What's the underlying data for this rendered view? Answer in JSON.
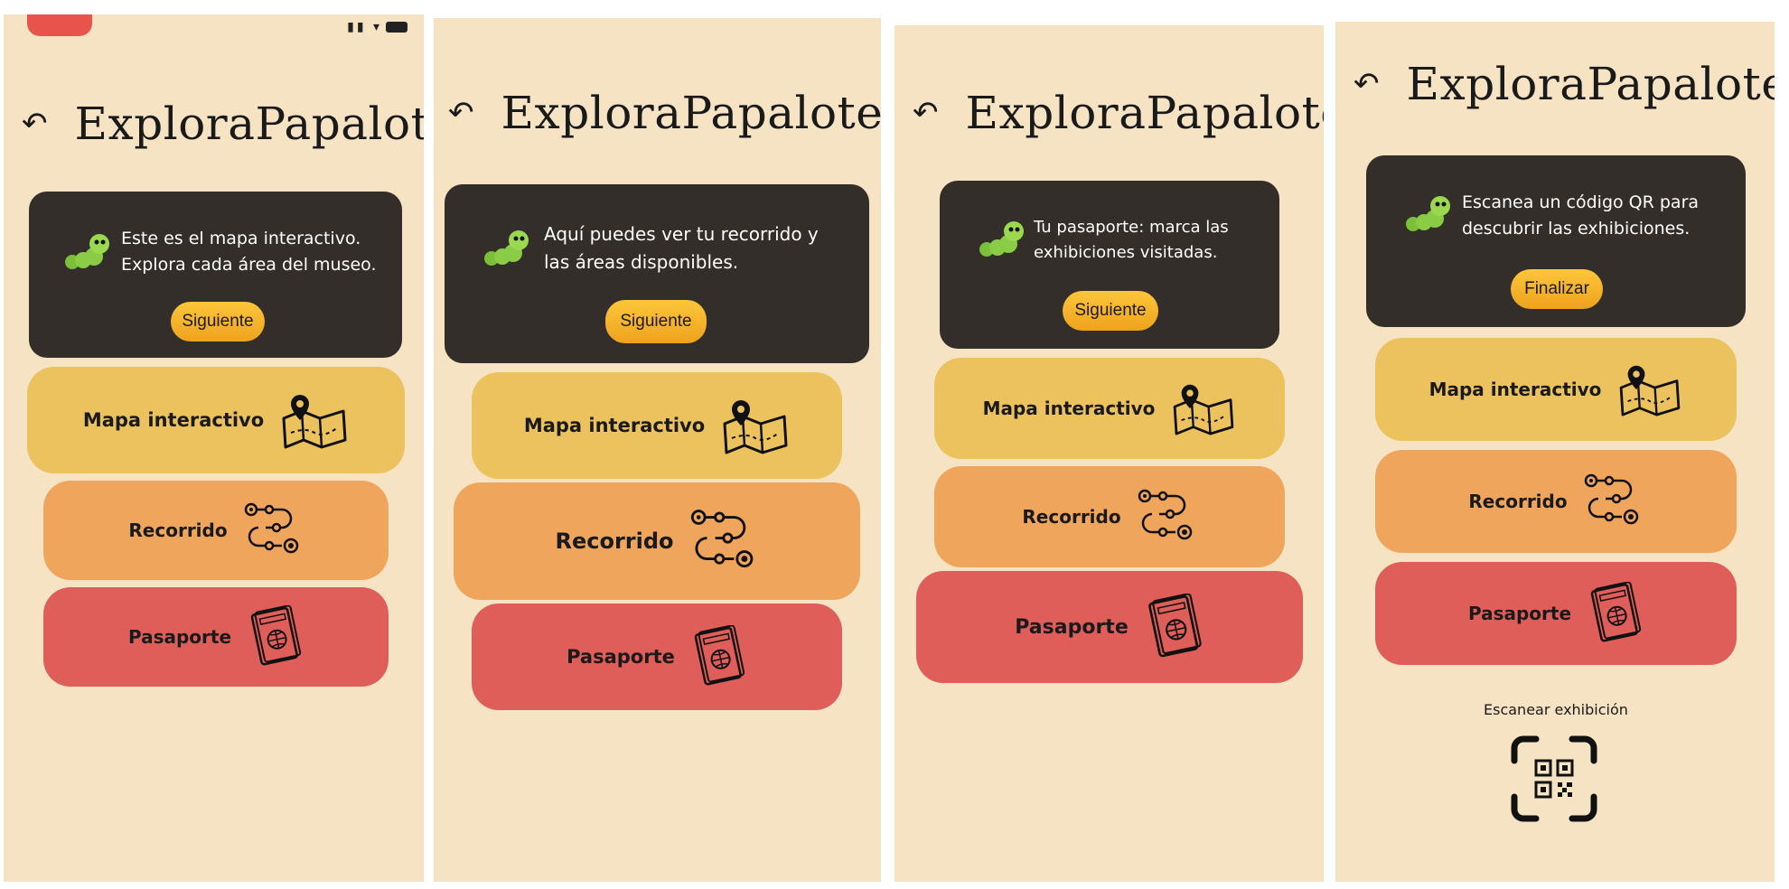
{
  "app": {
    "title": "ExploraPapalote"
  },
  "menu": {
    "map_label": "Mapa interactivo",
    "route_label": "Recorrido",
    "passport_label": "Pasaporte"
  },
  "screens": [
    {
      "tip_line1": "Este es el mapa interactivo.",
      "tip_line2": "Explora cada área del museo.",
      "button": "Siguiente"
    },
    {
      "tip_line1": "Aquí puedes ver tu recorrido y",
      "tip_line2": "las áreas disponibles.",
      "button": "Siguiente"
    },
    {
      "tip_line1": "Tu pasaporte: marca las",
      "tip_line2": "exhibiciones visitadas.",
      "button": "Siguiente"
    },
    {
      "tip_line1": "Escanea un código QR para",
      "tip_line2": "descubrir las exhibiciones.",
      "button": "Finalizar"
    }
  ],
  "scan": {
    "label": "Escanear exhibición"
  },
  "icons": {
    "back": "back-arrow-icon",
    "mascot": "caterpillar-icon",
    "map": "map-pin-icon",
    "route": "route-path-icon",
    "passport": "passport-icon",
    "scan": "qr-scan-icon"
  },
  "colors": {
    "background": "#f5e3c3",
    "tip_card": "#332e2a",
    "button": "#f7b52c",
    "map": "#ecc25e",
    "route": "#f0a55c",
    "passport": "#e05e5a"
  }
}
